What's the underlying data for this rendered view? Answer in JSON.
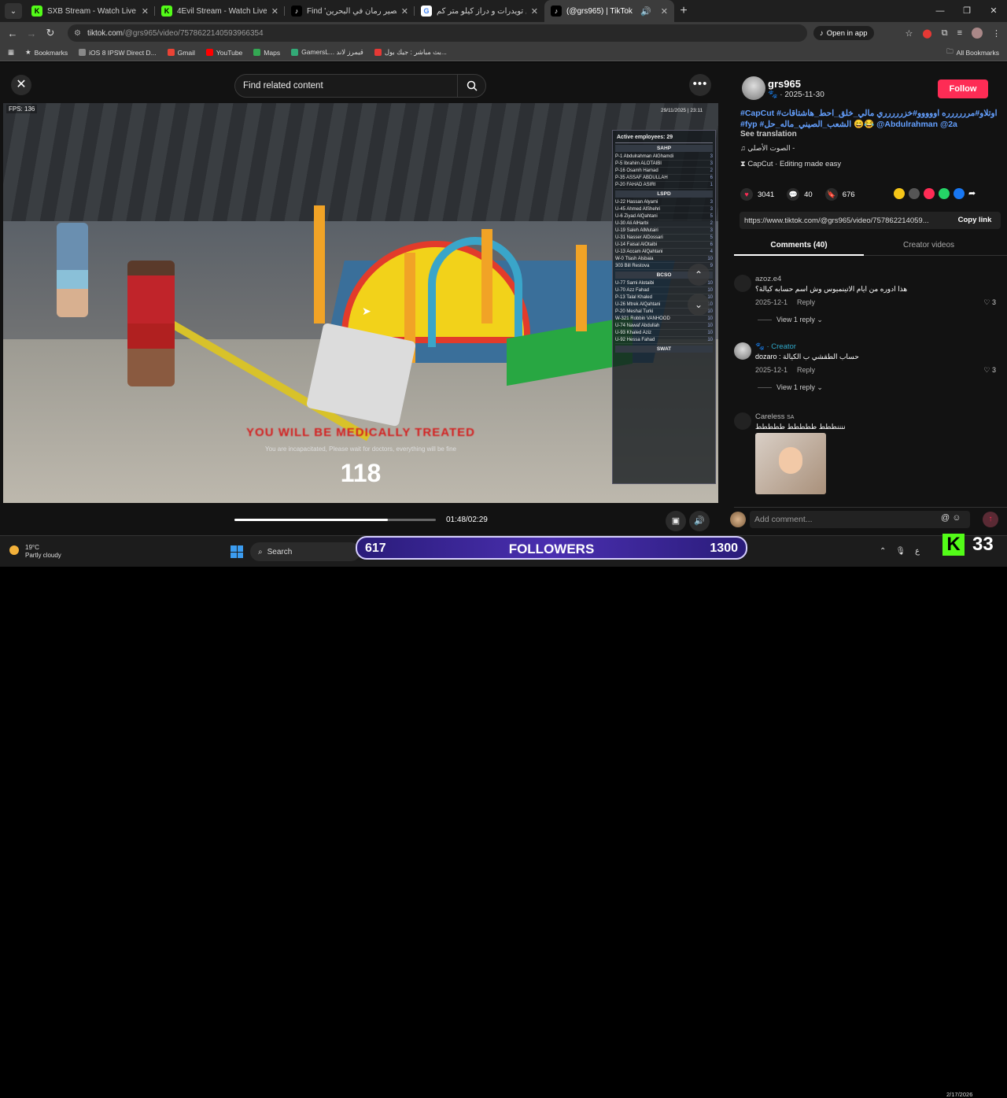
{
  "browser": {
    "tabs": [
      {
        "title": "SXB Stream - Watch Live on Kick",
        "icon": "kick-icon",
        "color": "#53fc18"
      },
      {
        "title": "4Evil Stream - Watch Live on Kick",
        "icon": "kick-icon",
        "color": "#53fc18"
      },
      {
        "title": "Find 'عصير رمان في البحرين' on",
        "icon": "tiktok-icon",
        "color": "#000000"
      },
      {
        "title": "بين تويدرات و دراز كيلو متر كم -",
        "icon": "google-icon",
        "color": "#ffffff"
      },
      {
        "title": "(@grs965) | TikTok",
        "icon": "tiktok-icon",
        "color": "#000000",
        "active": true
      }
    ],
    "url_domain": "tiktok.com",
    "url_path": "/@grs965/video/7578622140593966354",
    "open_in_app": "Open in app",
    "bookmarks": [
      {
        "label": "Bookmarks",
        "icon": "star-icon",
        "color": "#dddddd"
      },
      {
        "label": "iOS 8 IPSW Direct D...",
        "icon": "ios-icon",
        "color": "#888888"
      },
      {
        "label": "Gmail",
        "icon": "gmail-icon",
        "color": "#ea4335"
      },
      {
        "label": "YouTube",
        "icon": "youtube-icon",
        "color": "#ff0000"
      },
      {
        "label": "Maps",
        "icon": "maps-icon",
        "color": "#34a853"
      },
      {
        "label": "GamersL... قيمرز لاند",
        "icon": "gamers-icon",
        "color": "#33aa77"
      },
      {
        "label": "بث مباشر : جيك بول...",
        "icon": "live-icon",
        "color": "#e53935"
      }
    ],
    "all_bookmarks": "All Bookmarks"
  },
  "video": {
    "search_placeholder": "Find related content",
    "fps": "FPS: 136",
    "game_date": "29/11/2025 | 23:11",
    "scoreboard": {
      "header": "Active employees: 29",
      "sections": [
        {
          "name": "SAHP",
          "rows": [
            [
              "P-1 Abdulrahman AlGhamdi",
              "3"
            ],
            [
              "P-5 Ibrahim ALOTAIBI",
              "3"
            ],
            [
              "P-16 Osamh Hamad",
              "2"
            ],
            [
              "P-35 ASSAF ABDULLAH",
              "6"
            ],
            [
              "P-20 FAHAD ASIRI",
              "1"
            ]
          ]
        },
        {
          "name": "LSPD",
          "rows": [
            [
              "U-22 Hassan Alyami",
              "3"
            ],
            [
              "U-45 Ahmed AlShehri",
              "3"
            ],
            [
              "U-6 Ziyad AlQahtani",
              "5"
            ],
            [
              "U-30 Ali AlHarbi",
              "2"
            ],
            [
              "U-19 Saleh AlMutairi",
              "3"
            ],
            [
              "U-31 Nasser AlDossari",
              "5"
            ],
            [
              "U-14 Faisal AlOtaibi",
              "6"
            ],
            [
              "U-13 Accam AlQahtani",
              "4"
            ],
            [
              "W-0 Ttash Alsbaia",
              "10"
            ],
            [
              "303 Bill Restova",
              "9"
            ]
          ]
        },
        {
          "name": "BCSO",
          "rows": [
            [
              "U-77 Sami Alotaibi",
              "10"
            ],
            [
              "U-70 Azz Fahad",
              "10"
            ],
            [
              "P-13 Talal Khaled",
              "10"
            ],
            [
              "U-26 Mtrek AlQahtani",
              "10"
            ],
            [
              "P-20 Meshal Turki",
              "10"
            ],
            [
              "W-321 Robbin VANHOOD",
              "10"
            ],
            [
              "U-74 Nawaf Abdullah",
              "10"
            ],
            [
              "U-93 Khaled Aziz",
              "10"
            ],
            [
              "U-92 Hessa Fahad",
              "10"
            ]
          ]
        },
        {
          "name": "SWAT",
          "rows": []
        }
      ]
    },
    "incap_title": "YOU WILL BE MEDICALLY TREATED",
    "incap_sub": "You are incapacitated, Please wait for doctors, everything will be fine",
    "countdown": "118",
    "progress": 0.76,
    "time": "01:48/02:29"
  },
  "post": {
    "username": "grs965",
    "date": "· 2025-11-30",
    "follow": "Follow",
    "desc_line1": "#CapCut #اوتلاو#مرررررره اووووو#خزررررري مالي_خلق_احط_هاشتاقات",
    "desc_line2": "#fyp #الشعب_الصيني_ماله_حل 😄😂 @Abdulrahman @2a",
    "see_translation": "See translation",
    "sound": "♫ الصوت الأصلي -",
    "capcut": "CapCut · Editing made easy",
    "likes": "3041",
    "comments": "40",
    "saves": "676",
    "share_colors": [
      "#f5c518",
      "#555555",
      "#fe2c55",
      "#25d366",
      "#1877f2"
    ],
    "link": "https://www.tiktok.com/@grs965/video/757862214059...",
    "copy_link": "Copy link",
    "tab_comments": "Comments (40)",
    "tab_creator": "Creator videos"
  },
  "comments": [
    {
      "user": "azoz.e4",
      "text": "هذا ادوره من ايام الاتينميوس وش اسم حسابه كيالة؟",
      "date": "2025-12-1",
      "reply": "Reply",
      "likes": "3",
      "view_replies": "View 1 reply"
    },
    {
      "user": "dozaro",
      "creator_label": "· Creator",
      "text": "dozaro : حساب الطقشي ب الكيالة",
      "date": "2025-12-1",
      "reply": "Reply",
      "likes": "3",
      "view_replies": "View 1 reply"
    },
    {
      "user": "Careless",
      "badge": "SA",
      "text": "ننننططط ططططط ططططط"
    }
  ],
  "comment_placeholder": "Add comment...",
  "taskbar": {
    "temp": "19°C",
    "weather": "Partly cloudy",
    "search": "Search",
    "followers_left": "617",
    "followers_label": "FOLLOWERS",
    "followers_right": "1300",
    "kick_count": "33",
    "date": "2/17/2026",
    "app_colors": [
      "#e0245e",
      "#d83b01",
      "#107c10",
      "#ffffff",
      "#5865f2",
      "#777777",
      "#4285f4",
      "#1b9de2",
      "#1db954",
      "#3b82f6"
    ]
  }
}
